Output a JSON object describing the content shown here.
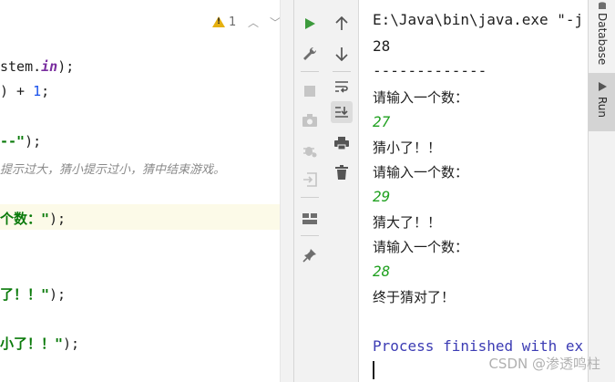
{
  "editor": {
    "warning_count": "1",
    "lines": {
      "l1_pre": "stem.",
      "l1_kw": "in",
      "l1_post": ");",
      "l2_pre": ") + ",
      "l2_num": "1",
      "l2_post": ";",
      "l3": "--\");",
      "l4_comment": "提示过大，猜小提示过小，猜中结束游戏。",
      "l5_str": "个数：\"",
      "l5_post": ");",
      "l6_str": "了！！\"",
      "l6_post": ");",
      "l7_str": "小了！！\"",
      "l7_post": ");"
    }
  },
  "toolbar_left": {
    "run": "run-icon",
    "settings": "wrench-icon",
    "stop": "stop-icon",
    "camera": "camera-icon",
    "debug": "debug-icon",
    "login": "enter-icon",
    "layout": "layout-icon",
    "pin": "pin-icon"
  },
  "toolbar_right": {
    "up": "arrow-up-icon",
    "down": "arrow-down-icon",
    "wrap": "soft-wrap-icon",
    "scroll_end": "scroll-to-end-icon",
    "print": "print-icon",
    "trash": "trash-icon"
  },
  "console": {
    "command": "E:\\Java\\bin\\java.exe \"-j",
    "lines": [
      "28",
      "-------------",
      "请输入一个数：",
      "27",
      "猜小了！！",
      "请输入一个数：",
      "29",
      "猜大了！！",
      "请输入一个数：",
      "28",
      "终于猜对了！"
    ],
    "process": "Process finished with ex"
  },
  "right_panel": {
    "database_label": "Database",
    "run_label": "Run"
  },
  "watermark": "CSDN @渗透鸣柱",
  "colors": {
    "input_green": "#21a121",
    "process_blue": "#3c3cb4",
    "warning_yellow": "#e5b00f"
  }
}
